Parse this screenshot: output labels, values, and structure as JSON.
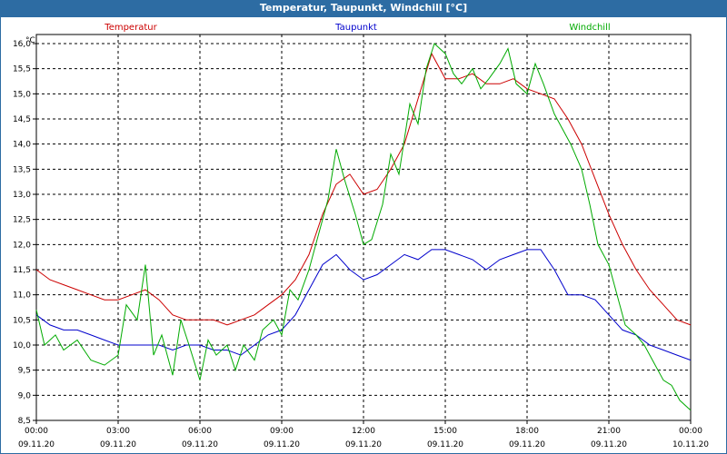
{
  "window": {
    "title": "Temperatur, Taupunkt, Windchill [°C]"
  },
  "chart_data": {
    "type": "line",
    "unit": "°C",
    "ylim": [
      8.5,
      16.0
    ],
    "yticks": [
      "8,5",
      "9,0",
      "9,5",
      "10,0",
      "10,5",
      "11,0",
      "11,5",
      "12,0",
      "12,5",
      "13,0",
      "13,5",
      "14,0",
      "14,5",
      "15,0",
      "15,5",
      "16,0"
    ],
    "xlim": [
      0,
      24
    ],
    "xticks": [
      {
        "h": 0,
        "time": "00:00",
        "date": "09.11.20"
      },
      {
        "h": 3,
        "time": "03:00",
        "date": "09.11.20"
      },
      {
        "h": 6,
        "time": "06:00",
        "date": "09.11.20"
      },
      {
        "h": 9,
        "time": "09:00",
        "date": "09.11.20"
      },
      {
        "h": 12,
        "time": "12:00",
        "date": "09.11.20"
      },
      {
        "h": 15,
        "time": "15:00",
        "date": "09.11.20"
      },
      {
        "h": 18,
        "time": "18:00",
        "date": "09.11.20"
      },
      {
        "h": 21,
        "time": "21:00",
        "date": "09.11.20"
      },
      {
        "h": 24,
        "time": "00:00",
        "date": "10.11.20"
      }
    ],
    "grid": true,
    "series": [
      {
        "name": "Temperatur",
        "color": "#cc0000",
        "points": [
          [
            0,
            11.5
          ],
          [
            0.5,
            11.3
          ],
          [
            1,
            11.2
          ],
          [
            1.5,
            11.1
          ],
          [
            2,
            11.0
          ],
          [
            2.5,
            10.9
          ],
          [
            3,
            10.9
          ],
          [
            3.5,
            11.0
          ],
          [
            4,
            11.1
          ],
          [
            4.5,
            10.9
          ],
          [
            5,
            10.6
          ],
          [
            5.5,
            10.5
          ],
          [
            6,
            10.5
          ],
          [
            6.5,
            10.5
          ],
          [
            7,
            10.4
          ],
          [
            7.5,
            10.5
          ],
          [
            8,
            10.6
          ],
          [
            8.5,
            10.8
          ],
          [
            9,
            11.0
          ],
          [
            9.5,
            11.3
          ],
          [
            10,
            11.8
          ],
          [
            10.5,
            12.6
          ],
          [
            11,
            13.2
          ],
          [
            11.5,
            13.4
          ],
          [
            12,
            13.0
          ],
          [
            12.5,
            13.1
          ],
          [
            13,
            13.5
          ],
          [
            13.5,
            14.0
          ],
          [
            14,
            14.9
          ],
          [
            14.5,
            15.8
          ],
          [
            15,
            15.3
          ],
          [
            15.5,
            15.3
          ],
          [
            16,
            15.4
          ],
          [
            16.5,
            15.2
          ],
          [
            17,
            15.2
          ],
          [
            17.5,
            15.3
          ],
          [
            18,
            15.1
          ],
          [
            18.5,
            15.0
          ],
          [
            19,
            14.9
          ],
          [
            19.5,
            14.5
          ],
          [
            20,
            14.0
          ],
          [
            20.5,
            13.3
          ],
          [
            21,
            12.6
          ],
          [
            21.5,
            12.0
          ],
          [
            22,
            11.5
          ],
          [
            22.5,
            11.1
          ],
          [
            23,
            10.8
          ],
          [
            23.5,
            10.5
          ],
          [
            24,
            10.4
          ]
        ]
      },
      {
        "name": "Taupunkt",
        "color": "#0000cc",
        "points": [
          [
            0,
            10.6
          ],
          [
            0.5,
            10.4
          ],
          [
            1,
            10.3
          ],
          [
            1.5,
            10.3
          ],
          [
            2,
            10.2
          ],
          [
            2.5,
            10.1
          ],
          [
            3,
            10.0
          ],
          [
            3.5,
            10.0
          ],
          [
            4,
            10.0
          ],
          [
            4.5,
            10.0
          ],
          [
            5,
            9.9
          ],
          [
            5.5,
            10.0
          ],
          [
            6,
            10.0
          ],
          [
            6.5,
            9.9
          ],
          [
            7,
            9.9
          ],
          [
            7.5,
            9.8
          ],
          [
            8,
            10.0
          ],
          [
            8.5,
            10.2
          ],
          [
            9,
            10.3
          ],
          [
            9.5,
            10.6
          ],
          [
            10,
            11.1
          ],
          [
            10.5,
            11.6
          ],
          [
            11,
            11.8
          ],
          [
            11.5,
            11.5
          ],
          [
            12,
            11.3
          ],
          [
            12.5,
            11.4
          ],
          [
            13,
            11.6
          ],
          [
            13.5,
            11.8
          ],
          [
            14,
            11.7
          ],
          [
            14.5,
            11.9
          ],
          [
            15,
            11.9
          ],
          [
            15.5,
            11.8
          ],
          [
            16,
            11.7
          ],
          [
            16.5,
            11.5
          ],
          [
            17,
            11.7
          ],
          [
            17.5,
            11.8
          ],
          [
            18,
            11.9
          ],
          [
            18.5,
            11.9
          ],
          [
            19,
            11.5
          ],
          [
            19.5,
            11.0
          ],
          [
            20,
            11.0
          ],
          [
            20.5,
            10.9
          ],
          [
            21,
            10.6
          ],
          [
            21.5,
            10.3
          ],
          [
            22,
            10.2
          ],
          [
            22.5,
            10.0
          ],
          [
            23,
            9.9
          ],
          [
            23.5,
            9.8
          ],
          [
            24,
            9.7
          ]
        ]
      },
      {
        "name": "Windchill",
        "color": "#00aa00",
        "points": [
          [
            0,
            10.7
          ],
          [
            0.3,
            10.0
          ],
          [
            0.7,
            10.2
          ],
          [
            1,
            9.9
          ],
          [
            1.5,
            10.1
          ],
          [
            2,
            9.7
          ],
          [
            2.5,
            9.6
          ],
          [
            3,
            9.8
          ],
          [
            3.3,
            10.8
          ],
          [
            3.7,
            10.5
          ],
          [
            4,
            11.6
          ],
          [
            4.3,
            9.8
          ],
          [
            4.6,
            10.2
          ],
          [
            5,
            9.4
          ],
          [
            5.3,
            10.5
          ],
          [
            5.6,
            10.0
          ],
          [
            6,
            9.3
          ],
          [
            6.3,
            10.1
          ],
          [
            6.6,
            9.8
          ],
          [
            7,
            10.0
          ],
          [
            7.3,
            9.5
          ],
          [
            7.6,
            10.0
          ],
          [
            8,
            9.7
          ],
          [
            8.3,
            10.3
          ],
          [
            8.7,
            10.5
          ],
          [
            9,
            10.2
          ],
          [
            9.3,
            11.1
          ],
          [
            9.6,
            10.9
          ],
          [
            10,
            11.5
          ],
          [
            10.3,
            12.1
          ],
          [
            10.7,
            12.9
          ],
          [
            11,
            13.9
          ],
          [
            11.3,
            13.3
          ],
          [
            11.7,
            12.6
          ],
          [
            12,
            12.0
          ],
          [
            12.3,
            12.1
          ],
          [
            12.7,
            12.8
          ],
          [
            13,
            13.8
          ],
          [
            13.3,
            13.4
          ],
          [
            13.7,
            14.8
          ],
          [
            14,
            14.4
          ],
          [
            14.3,
            15.5
          ],
          [
            14.6,
            16.0
          ],
          [
            15,
            15.8
          ],
          [
            15.3,
            15.4
          ],
          [
            15.6,
            15.2
          ],
          [
            16,
            15.5
          ],
          [
            16.3,
            15.1
          ],
          [
            16.6,
            15.3
          ],
          [
            17,
            15.6
          ],
          [
            17.3,
            15.9
          ],
          [
            17.6,
            15.2
          ],
          [
            18,
            15.0
          ],
          [
            18.3,
            15.6
          ],
          [
            18.6,
            15.2
          ],
          [
            19,
            14.6
          ],
          [
            19.3,
            14.3
          ],
          [
            19.6,
            14.0
          ],
          [
            20,
            13.5
          ],
          [
            20.3,
            12.8
          ],
          [
            20.6,
            12.0
          ],
          [
            21,
            11.6
          ],
          [
            21.3,
            11.0
          ],
          [
            21.6,
            10.4
          ],
          [
            22,
            10.2
          ],
          [
            22.3,
            10.0
          ],
          [
            22.6,
            9.7
          ],
          [
            23,
            9.3
          ],
          [
            23.3,
            9.2
          ],
          [
            23.6,
            8.9
          ],
          [
            24,
            8.7
          ]
        ]
      }
    ]
  }
}
